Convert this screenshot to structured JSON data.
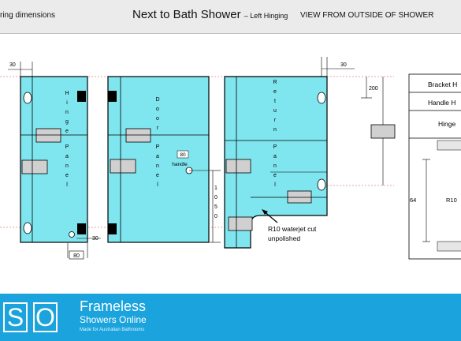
{
  "header": {
    "left_text": "ring dimensions",
    "title": "Next to Bath Shower",
    "subtitle": "– Left Hinging",
    "view": "VIEW FROM OUTSIDE OF SHOWER"
  },
  "panels": {
    "hinge": [
      "H",
      "i",
      "n",
      "g",
      "e",
      "P",
      "a",
      "n",
      "e",
      "l"
    ],
    "door": [
      "D",
      "o",
      "o",
      "r",
      "P",
      "a",
      "n",
      "e",
      "l"
    ],
    "return": [
      "R",
      "e",
      "t",
      "u",
      "r",
      "n",
      "P",
      "a",
      "n",
      "e",
      "l"
    ]
  },
  "dimensions": {
    "top_left": "30",
    "hinge_bottom": "30",
    "hinge_offset": "80",
    "handle_offset": "80",
    "handle_label": "handle",
    "handle_height": [
      "1",
      "0",
      "5",
      "0"
    ],
    "return_top": "30",
    "return_side": "200"
  },
  "annotation": {
    "line1": "R10 waterjet cut",
    "line2": "unpolished"
  },
  "table": {
    "row1": "Bracket H",
    "row2": "Handle H",
    "row3": "Hinge",
    "dim": "64",
    "radius": "R10"
  },
  "footer": {
    "logo_left": "S",
    "logo_right": "O",
    "brand_line1": "Frameless",
    "brand_line2": "Showers Online",
    "tagline": "Made for Australian Bathrooms"
  }
}
